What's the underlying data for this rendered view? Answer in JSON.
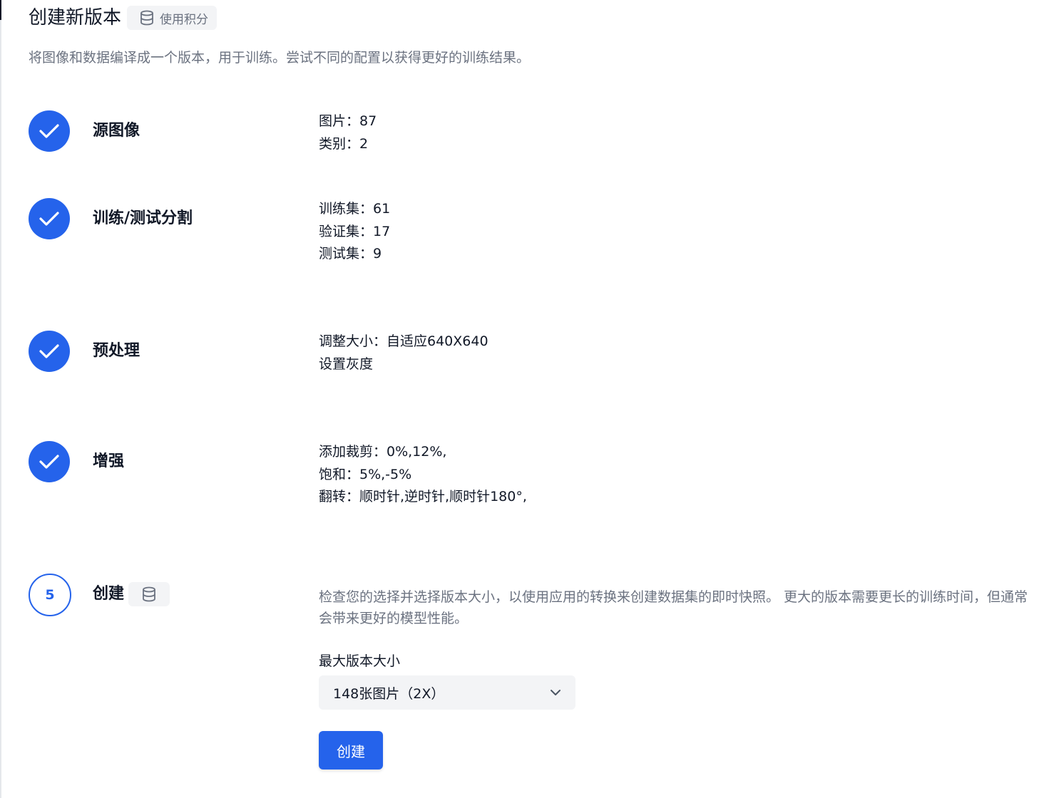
{
  "header": {
    "title": "创建新版本",
    "credits_label": "使用积分"
  },
  "subtitle": "将图像和数据编译成一个版本，用于训练。尝试不同的配置以获得更好的训练结果。",
  "colors": {
    "accent": "#2563eb",
    "muted_text": "#6b7280",
    "badge_bg": "#f3f4f6"
  },
  "steps": [
    {
      "title": "源图像",
      "status": "completed",
      "details": [
        "图片：87",
        "类别：2"
      ]
    },
    {
      "title": "训练/测试分割",
      "status": "completed",
      "details": [
        "训练集：61",
        "验证集：17",
        "测试集：9"
      ]
    },
    {
      "title": "预处理",
      "status": "completed",
      "details": [
        "调整大小：自适应640X640",
        "设置灰度"
      ]
    },
    {
      "title": "增强",
      "status": "completed",
      "details": [
        "添加裁剪：0%,12%,",
        "饱和：5%,-5%",
        "翻转：顺时针,逆时针,顺时针180°,"
      ]
    },
    {
      "number": "5",
      "title": "创建",
      "status": "active",
      "description": "检查您的选择并选择版本大小，以使用应用的转换来创建数据集的即时快照。 更大的版本需要更长的训练时间，但通常会带来更好的模型性能。",
      "size_label": "最大版本大小",
      "size_selected": "148张图片（2X）",
      "create_label": "创建"
    }
  ],
  "icons": {
    "completed": "check-icon",
    "credits": "database-icon",
    "dropdown": "chevron-down-icon"
  }
}
